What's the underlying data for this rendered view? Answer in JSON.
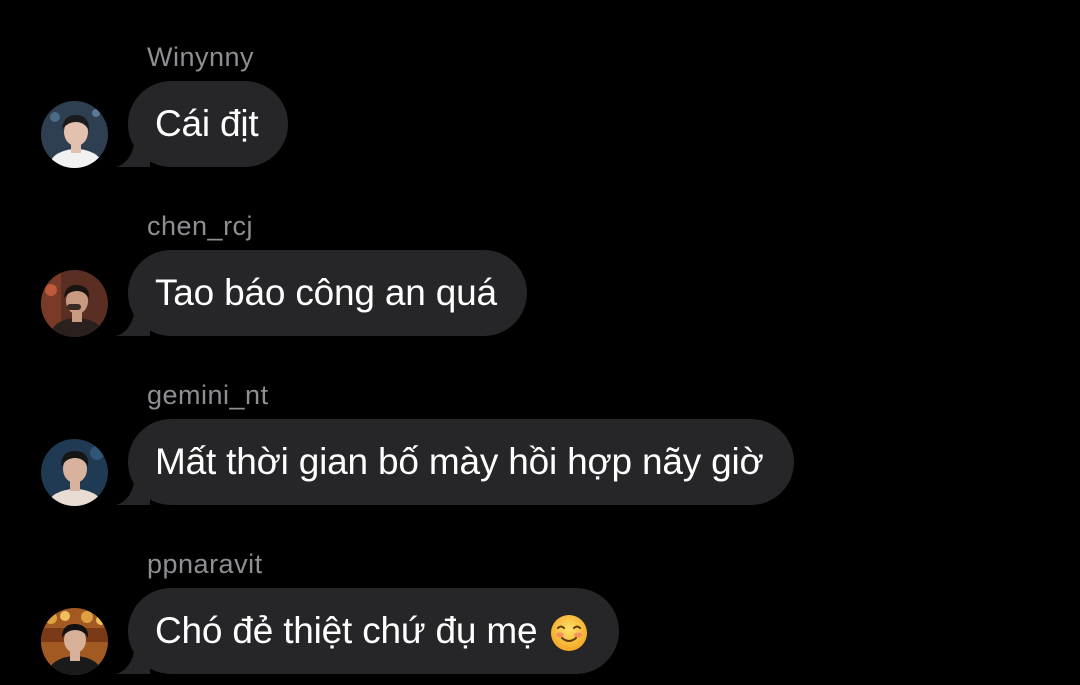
{
  "messages": [
    {
      "sender": "Winynny",
      "text": "Cái địt",
      "avatar_icon": "user-avatar-photo",
      "avatar_colors": {
        "bg": "#2e3f52",
        "skin": "#e2c2ae",
        "hair": "#1b1a1e",
        "shirt": "#f1f1f1"
      }
    },
    {
      "sender": "chen_rcj",
      "text": "Tao báo công an quá",
      "avatar_icon": "user-avatar-photo",
      "avatar_colors": {
        "bg": "#5a2e22",
        "skin": "#c99a80",
        "hair": "#1a1410",
        "shirt": "#2a211f"
      }
    },
    {
      "sender": "gemini_nt",
      "text": "Mất thời gian bố mày hồi hợp nãy giờ",
      "avatar_icon": "user-avatar-photo",
      "avatar_colors": {
        "bg": "#1f3a52",
        "skin": "#d8b29c",
        "hair": "#151515",
        "shirt": "#e9ddd3"
      }
    },
    {
      "sender": "ppnaravit",
      "text": "Chó đẻ thiệt chứ đụ mẹ",
      "emoji": "☺️",
      "emoji_icon": "smiling-face-emoji-icon",
      "avatar_icon": "user-avatar-photo",
      "avatar_colors": {
        "bg": "#a35a22",
        "skin": "#d6b098",
        "hair": "#111111",
        "shirt": "#1a1a1a"
      }
    }
  ],
  "theme": {
    "background": "#000000",
    "bubble": "#262629",
    "sender_name": "#8e8e93",
    "message_text": "#ffffff"
  }
}
